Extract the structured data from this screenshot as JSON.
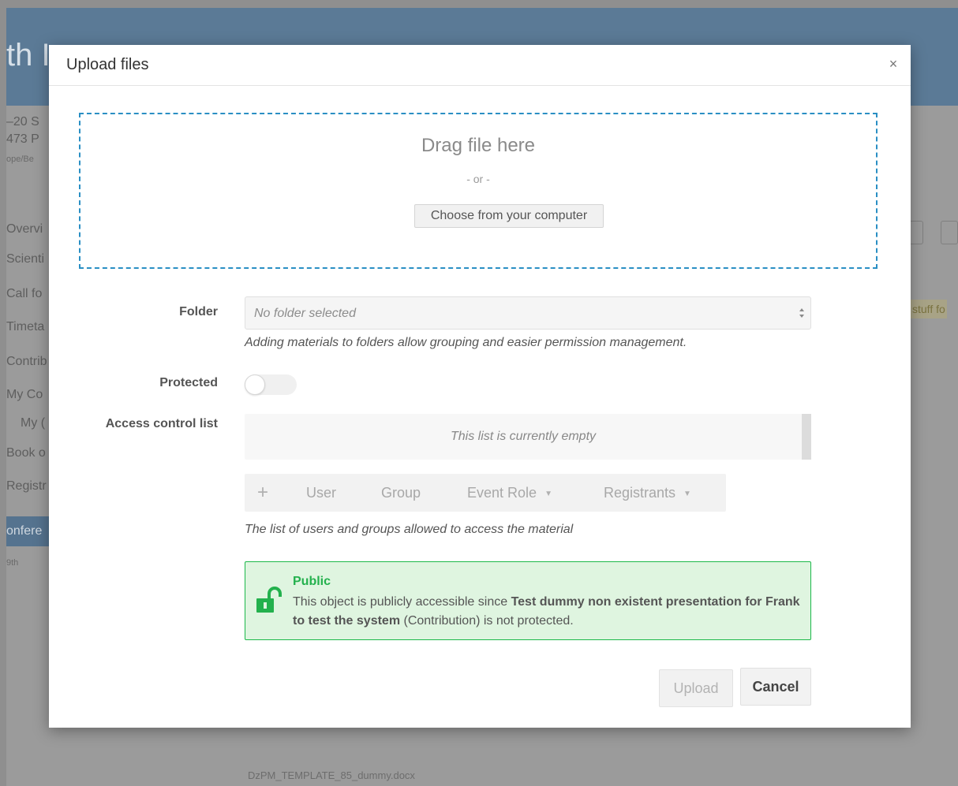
{
  "background": {
    "header_title": "th I",
    "left_items": [
      "–20 S",
      "473 P",
      "ope/Be",
      "Overvi",
      "Scienti",
      "Call fo",
      "Timeta",
      "Contrib",
      "My Co",
      "My (",
      "Book o",
      "Registr"
    ],
    "active_item": "onfere",
    "sub_item": "9th",
    "right_note": "stuff fo",
    "file_name": "DzPM_TEMPLATE_85_dummy.docx"
  },
  "modal": {
    "title": "Upload files",
    "close_icon": "×"
  },
  "dropzone": {
    "title": "Drag file here",
    "or": "- or -",
    "choose_label": "Choose from your computer"
  },
  "folder": {
    "label": "Folder",
    "placeholder": "No folder selected",
    "help": "Adding materials to folders allow grouping and easier permission management."
  },
  "protected": {
    "label": "Protected",
    "enabled": false
  },
  "acl": {
    "label": "Access control list",
    "empty_text": "This list is currently empty",
    "toolbar": {
      "add_icon": "+",
      "user": "User",
      "group": "Group",
      "event_role": "Event Role",
      "registrants": "Registrants"
    },
    "help": "The list of users and groups allowed to access the material"
  },
  "public_notice": {
    "title": "Public",
    "prefix": "This object is publicly accessible since ",
    "object_name": "Test dummy non existent presentation for Frank to test the system",
    "suffix": " (Contribution) is not protected.",
    "color": "#23b14d"
  },
  "actions": {
    "upload": "Upload",
    "cancel": "Cancel"
  },
  "colors": {
    "dropzone_border": "#2a8fc4",
    "notice_bg": "#dff5e0",
    "notice_border": "#1cb84a"
  }
}
